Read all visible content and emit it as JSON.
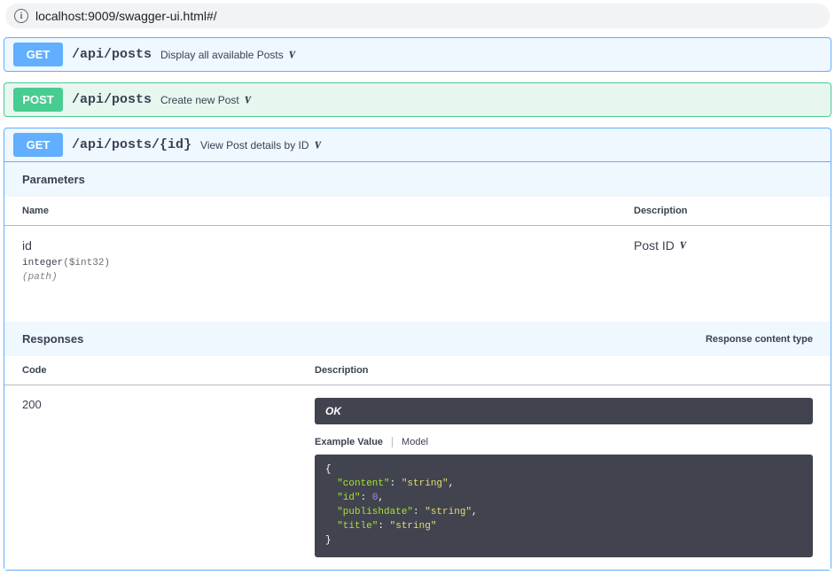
{
  "browser": {
    "url": "localhost:9009/swagger-ui.html#/"
  },
  "endpoints": [
    {
      "method": "GET",
      "path": "/api/posts",
      "summary": "Display all available Posts"
    },
    {
      "method": "POST",
      "path": "/api/posts",
      "summary": "Create new Post"
    },
    {
      "method": "GET",
      "path": "/api/posts/{id}",
      "summary": "View Post details by ID"
    }
  ],
  "sections": {
    "parameters_label": "Parameters",
    "responses_label": "Responses",
    "response_content_type_label": "Response content type"
  },
  "parameters_table": {
    "headers": {
      "name": "Name",
      "description": "Description"
    },
    "rows": [
      {
        "name": "id",
        "type": "integer",
        "format": "($int32)",
        "in": "(path)",
        "description": "Post ID"
      }
    ]
  },
  "responses_table": {
    "headers": {
      "code": "Code",
      "description": "Description"
    },
    "rows": [
      {
        "code": "200",
        "description": "OK",
        "tabs": {
          "example": "Example Value",
          "model": "Model"
        },
        "example": {
          "content": "string",
          "id": 0,
          "publishdate": "string",
          "title": "string"
        }
      }
    ]
  }
}
